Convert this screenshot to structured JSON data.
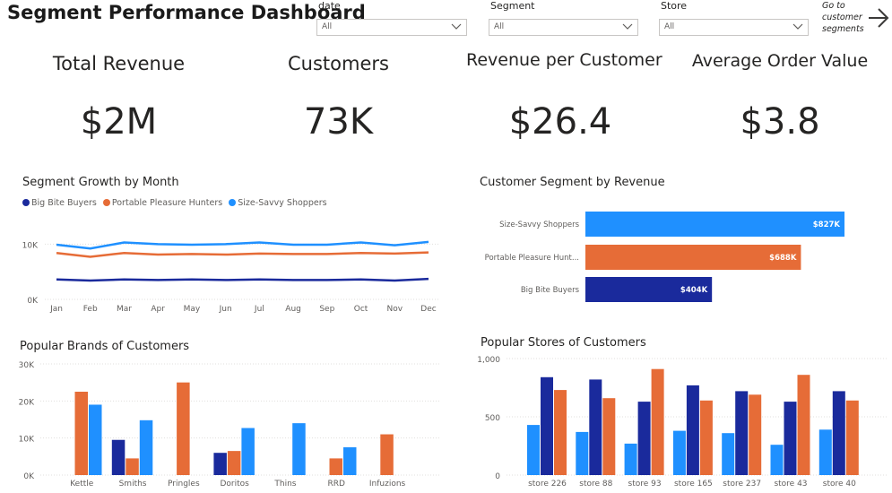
{
  "header": {
    "title": "Segment Performance Dashboard"
  },
  "filters": [
    {
      "label": "date",
      "value": "All"
    },
    {
      "label": "Segment",
      "value": "All"
    },
    {
      "label": "Store",
      "value": "All"
    }
  ],
  "nav": {
    "text_lines": [
      "Go to",
      "customer",
      "segments"
    ],
    "icon": "arrow-right-icon"
  },
  "kpis": [
    {
      "label": "Total Revenue",
      "value": "$2M"
    },
    {
      "label": "Customers",
      "value": "73K"
    },
    {
      "label": "Revenue per Customer",
      "value": "$26.4"
    },
    {
      "label": "Average Order Value",
      "value": "$3.8"
    }
  ],
  "colors": {
    "dark_blue": "#1a2a9c",
    "orange": "#e66c37",
    "light_blue": "#1f90ff",
    "grid": "#e1dfdd",
    "axis_text": "#605e5c"
  },
  "chart_data": [
    {
      "type": "line",
      "title": "Segment Growth by Month",
      "x": [
        "Jan",
        "Feb",
        "Mar",
        "Apr",
        "May",
        "Jun",
        "Jul",
        "Aug",
        "Sep",
        "Oct",
        "Nov",
        "Dec"
      ],
      "series": [
        {
          "name": "Big Bite Buyers",
          "color": "#1a2a9c",
          "values": [
            3600,
            3400,
            3600,
            3500,
            3600,
            3500,
            3600,
            3500,
            3500,
            3600,
            3400,
            3700
          ]
        },
        {
          "name": "Portable Pleasure Hunters",
          "color": "#e66c37",
          "values": [
            8400,
            7700,
            8400,
            8100,
            8200,
            8100,
            8300,
            8200,
            8200,
            8400,
            8300,
            8500
          ]
        },
        {
          "name": "Size-Savvy Shoppers",
          "color": "#1f90ff",
          "values": [
            9900,
            9200,
            10300,
            10000,
            9900,
            10000,
            10300,
            9900,
            9900,
            10300,
            9800,
            10400
          ]
        }
      ],
      "yticks": [
        "0K",
        "10K"
      ],
      "ylim": [
        0,
        12000
      ],
      "legend": "top-left",
      "grid": true
    },
    {
      "type": "bar",
      "orientation": "horizontal",
      "title": "Customer Segment by Revenue",
      "categories": [
        "Size-Savvy Shoppers",
        "Portable Pleasure Hunt...",
        "Big Bite Buyers"
      ],
      "values": [
        827000,
        688000,
        404000
      ],
      "data_labels": [
        "$827K",
        "$688K",
        "$404K"
      ],
      "colors": [
        "#1f90ff",
        "#e66c37",
        "#1a2a9c"
      ]
    },
    {
      "type": "bar",
      "title": "Popular Brands of Customers",
      "categories": [
        "Kettle",
        "Smiths",
        "Pringles",
        "Doritos",
        "Thins",
        "RRD",
        "Infuzions"
      ],
      "series": [
        {
          "color": "#1a2a9c",
          "values": [
            0,
            9500,
            0,
            6000,
            0,
            0,
            0
          ]
        },
        {
          "color": "#e66c37",
          "values": [
            22500,
            4500,
            25000,
            6500,
            0,
            4500,
            11000
          ]
        },
        {
          "color": "#1f90ff",
          "values": [
            19000,
            14800,
            0,
            12700,
            14000,
            7500,
            0
          ]
        }
      ],
      "yticks": [
        "0K",
        "10K",
        "20K",
        "30K"
      ],
      "ylim": [
        0,
        30000
      ],
      "grid": true
    },
    {
      "type": "bar",
      "title": "Popular Stores of Customers",
      "categories": [
        "store 226",
        "store 88",
        "store 93",
        "store 165",
        "store 237",
        "store 43",
        "store 40"
      ],
      "series": [
        {
          "color": "#1f90ff",
          "values": [
            430,
            370,
            270,
            380,
            360,
            260,
            390
          ]
        },
        {
          "color": "#1a2a9c",
          "values": [
            840,
            820,
            630,
            770,
            720,
            630,
            720
          ]
        },
        {
          "color": "#e66c37",
          "values": [
            730,
            660,
            910,
            640,
            690,
            860,
            640
          ]
        }
      ],
      "yticks": [
        "0",
        "500",
        "1,000"
      ],
      "ylim": [
        0,
        1000
      ],
      "grid": true
    }
  ]
}
